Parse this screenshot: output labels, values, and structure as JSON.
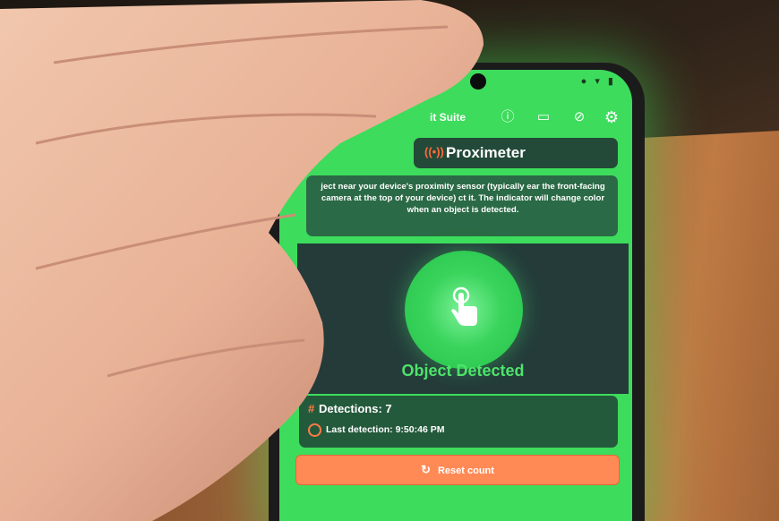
{
  "app": {
    "title_fragment": "it Suite",
    "status_icons": "● ▾ ▮"
  },
  "header": {
    "title": "Proximeter",
    "wave_icon": "signal-wave-icon"
  },
  "instructions": {
    "text": "ject near your device's proximity sensor (typically ear the front-facing camera at the top of your device) ct it. The indicator will change color when an object is detected."
  },
  "detector": {
    "status": "Object Detected",
    "icon": "touch-hand-icon"
  },
  "stats": {
    "detections_label": "Detections: 7",
    "last_detection_label": "Last detection: 9:50:46 PM"
  },
  "actions": {
    "reset_label": "Reset count"
  },
  "colors": {
    "screen_bg": "#3ddc5c",
    "card_dark": "#234a38",
    "accent_orange": "#ff8a55",
    "detected_green": "#4ee36b"
  }
}
